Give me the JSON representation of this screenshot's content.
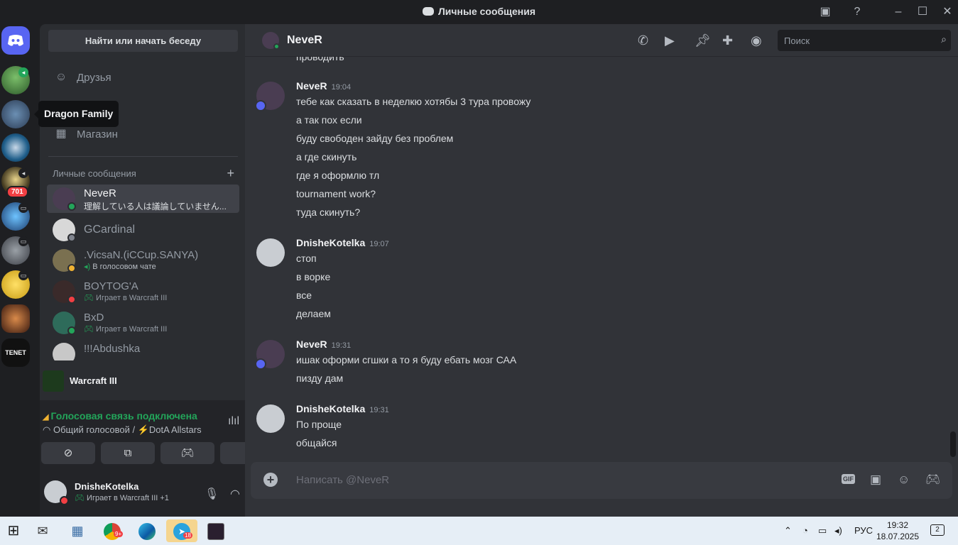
{
  "window": {
    "title": "Личные сообщения"
  },
  "servers": {
    "ping_count": "701",
    "tooltip": "Dragon Family",
    "tenet_label": "TENET"
  },
  "sidebar": {
    "find_button": "Найти или начать беседу",
    "nav": [
      {
        "label": "Друзья",
        "icon": "friends-icon"
      },
      {
        "label": "Магазин",
        "icon": "shop-icon"
      }
    ],
    "dm_header": "Личные сообщения",
    "dms": [
      {
        "name": "NeveR",
        "sub": "理解している人は議論していません...",
        "status": "online",
        "active": true
      },
      {
        "name": "GCardinal",
        "sub": "",
        "status": "offline"
      },
      {
        "name": ".VicsaN.(iCCup.SANYA)",
        "sub": "В голосовом чате",
        "status": "idle"
      },
      {
        "name": "BOYTOG'A",
        "sub": "Играет в Warcraft III",
        "status": "dnd"
      },
      {
        "name": "BxD",
        "sub": "Играет в Warcraft III",
        "status": "online"
      },
      {
        "name": "!!!Abdushka",
        "sub": "",
        "status": "dnd"
      }
    ]
  },
  "activity": {
    "game": "Warcraft III",
    "voice_status": "Голосовая связь подключена",
    "voice_channel": "Общий голосовой / ⚡DotA Allstars"
  },
  "user": {
    "name": "DnisheKotelka",
    "status_text": "Играет в Warcraft III",
    "extra": "+1"
  },
  "chat": {
    "recipient": "NeveR",
    "search_placeholder": "Поиск",
    "cut_line": "проводить",
    "groups": [
      {
        "author": "NeveR",
        "time": "19:04",
        "lines": [
          "тебе как сказать в неделкю хотябы 3 тура провожу",
          "а так пох если",
          "буду свободен зайду без проблем",
          "а где скинуть",
          "где я оформлю тл",
          "tournament work?",
          "туда скинуть?"
        ]
      },
      {
        "author": "DnisheKotelka",
        "time": "19:07",
        "lines": [
          "стоп",
          "в ворке",
          "все",
          "делаем"
        ]
      },
      {
        "author": "NeveR",
        "time": "19:31",
        "lines": [
          "ишак оформи сгшки а то я буду ебать мозг САА",
          "пизду дам"
        ]
      },
      {
        "author": "DnisheKotelka",
        "time": "19:31",
        "lines": [
          "По проще",
          "общайся"
        ]
      }
    ],
    "composer_placeholder": "Написать @NeveR",
    "gif_label": "GIF"
  },
  "taskbar": {
    "lang": "РУС",
    "time": "19:32",
    "date": "18.07.2025",
    "notifications": "2",
    "badges": {
      "chrome": "9+",
      "telegram": "18"
    }
  },
  "colors": {
    "blurple": "#5865f2",
    "online": "#23a55a",
    "dnd": "#f23f43",
    "idle": "#f0b232"
  }
}
